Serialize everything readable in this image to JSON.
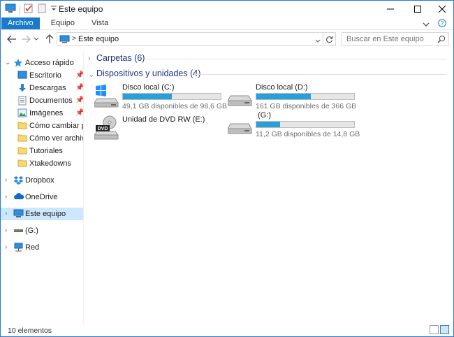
{
  "window": {
    "title": "Este equipo",
    "accent_color": "#1979ca"
  },
  "ribbon": {
    "tabs": [
      {
        "label": "Archivo",
        "active": true
      },
      {
        "label": "Equipo",
        "active": false
      },
      {
        "label": "Vista",
        "active": false
      }
    ]
  },
  "address": {
    "crumb": "Este equipo",
    "search_placeholder": "Buscar en Este equipo"
  },
  "navpane": {
    "items": [
      {
        "label": "Acceso rápido",
        "icon": "star-icon",
        "pinned": false
      },
      {
        "label": "Escritorio",
        "icon": "desktop-icon",
        "pinned": true
      },
      {
        "label": "Descargas",
        "icon": "download-arrow-icon",
        "pinned": true
      },
      {
        "label": "Documentos",
        "icon": "documents-icon",
        "pinned": true
      },
      {
        "label": "Imágenes",
        "icon": "pictures-icon",
        "pinned": true
      },
      {
        "label": "Cómo cambiar perr",
        "icon": "folder-icon",
        "pinned": false
      },
      {
        "label": "Cómo ver archivos y",
        "icon": "folder-icon",
        "pinned": false
      },
      {
        "label": "Tutoriales",
        "icon": "folder-icon",
        "pinned": false
      },
      {
        "label": "Xtakedowns",
        "icon": "folder-icon",
        "pinned": false
      },
      {
        "label": "Dropbox",
        "icon": "dropbox-icon",
        "pinned": false
      },
      {
        "label": "OneDrive",
        "icon": "cloud-icon",
        "pinned": false
      },
      {
        "label": "Este equipo",
        "icon": "computer-icon",
        "pinned": false,
        "selected": true
      },
      {
        "label": "(G:)",
        "icon": "usb-drive-icon",
        "pinned": false
      },
      {
        "label": "Red",
        "icon": "network-icon",
        "pinned": false
      }
    ]
  },
  "content": {
    "groups": [
      {
        "title": "Carpetas (6)",
        "expanded": false
      },
      {
        "title": "Dispositivos y unidades (4)",
        "expanded": true
      }
    ],
    "drives": [
      {
        "name": "Disco local (C:)",
        "info": "49,1 GB disponibles de 98,6 GB",
        "used_fraction": 0.502,
        "icon": "windows-drive-icon"
      },
      {
        "name": "Disco local (D:)",
        "info": "161 GB disponibles de 366 GB",
        "used_fraction": 0.56,
        "icon": "hard-drive-icon"
      },
      {
        "name": "Unidad de DVD RW (E:)",
        "info": "",
        "icon": "dvd-drive-icon"
      },
      {
        "name": " (G:)",
        "info": "11,2 GB disponibles de 14,8 GB",
        "used_fraction": 0.243,
        "icon": "usb-drive-icon"
      }
    ]
  },
  "status": {
    "count": "10 elementos"
  }
}
